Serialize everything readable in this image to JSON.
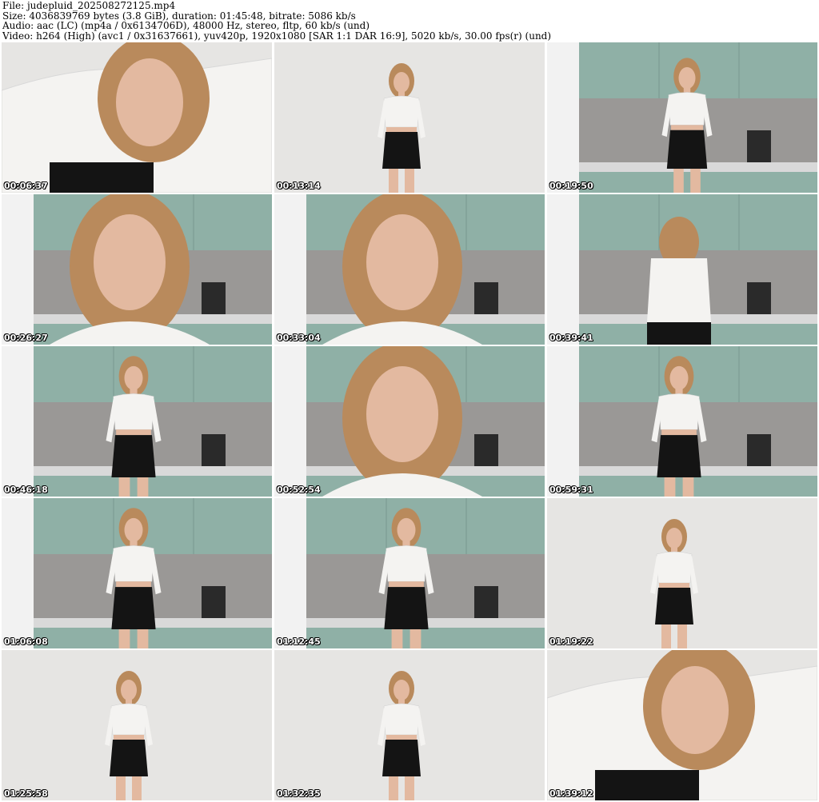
{
  "header": {
    "file_line": "File: judepluid_202508272125.mp4",
    "size_line": "Size: 4036839769 bytes (3.8 GiB), duration: 01:45:48, bitrate: 5086 kb/s",
    "audio_line": "Audio: aac (LC) (mp4a / 0x6134706D), 48000 Hz, stereo, fltp, 60 kb/s (und)",
    "video_line": "Video: h264 (High) (avc1 / 0x31637661), yuv420p, 1920x1080 [SAR 1:1 DAR 16:9], 5020 kb/s, 30.00 fps(r) (und)"
  },
  "thumbnails": [
    {
      "timestamp": "00:06:37",
      "scene": "closeup-wall"
    },
    {
      "timestamp": "00:13:14",
      "scene": "wall-standing"
    },
    {
      "timestamp": "00:19:50",
      "scene": "kitchen-sitting"
    },
    {
      "timestamp": "00:26:27",
      "scene": "kitchen-face"
    },
    {
      "timestamp": "00:33:04",
      "scene": "kitchen-face"
    },
    {
      "timestamp": "00:39:41",
      "scene": "kitchen-back"
    },
    {
      "timestamp": "00:46:18",
      "scene": "kitchen-standing"
    },
    {
      "timestamp": "00:52:54",
      "scene": "kitchen-face"
    },
    {
      "timestamp": "00:59:31",
      "scene": "kitchen-standing"
    },
    {
      "timestamp": "01:06:08",
      "scene": "kitchen-standing"
    },
    {
      "timestamp": "01:12:45",
      "scene": "kitchen-standing"
    },
    {
      "timestamp": "01:19:22",
      "scene": "wall-standing"
    },
    {
      "timestamp": "01:25:58",
      "scene": "wall-standing"
    },
    {
      "timestamp": "01:32:35",
      "scene": "wall-standing"
    },
    {
      "timestamp": "01:39:12",
      "scene": "closeup-wall"
    }
  ],
  "colors": {
    "wall": "#e6e5e3",
    "cabinet": "#8fb0a6",
    "backsplash": "#9a9896",
    "hair": "#b98a5c",
    "top": "#f4f3f1",
    "skirt": "#141414",
    "skin": "#e3b9a0"
  }
}
